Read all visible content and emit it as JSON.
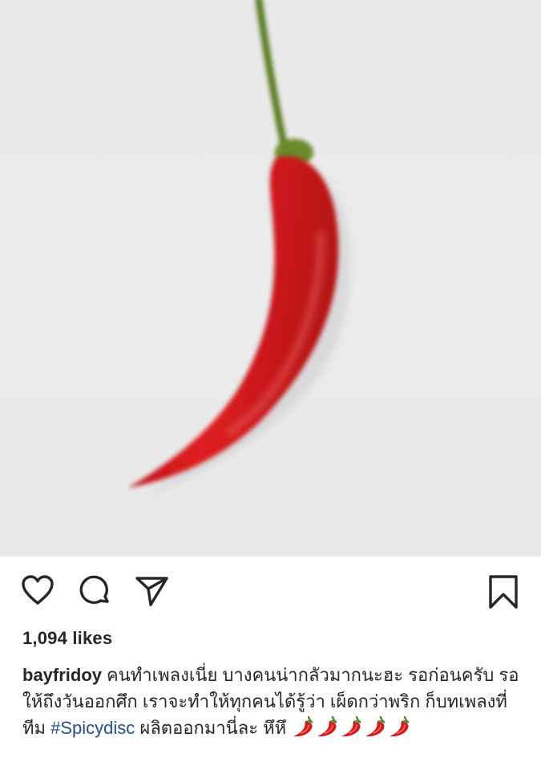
{
  "post": {
    "image_subject": "red-chili-pepper",
    "colors": {
      "chili_red": "#d8191c",
      "stem_green": "#5a7a24",
      "background": "#ebebec",
      "hashtag_blue": "#234d8c",
      "text": "#262626"
    }
  },
  "actions": {
    "like": "heart-outline",
    "comment": "speech-bubble",
    "share": "paper-plane",
    "save": "bookmark-outline"
  },
  "likes_text": "1,094 likes",
  "caption": {
    "username": "bayfridoy",
    "text_before_hashtag": "คนทำเพลงเนี่ย บางคนน่ากลัวมากนะฮะ รอก่อนครับ รอให้ถึงวันออกศึก เราจะทำให้ทุกคนได้รู้ว่า เผ็ดกว่าพริก ก็บทเพลงที่ทีม",
    "hashtag": "#Spicydisc",
    "text_after_hashtag": "ผลิตออกมานี่ละ หึหึ",
    "emoji_name": "hot-pepper",
    "emoji_count": 5
  }
}
